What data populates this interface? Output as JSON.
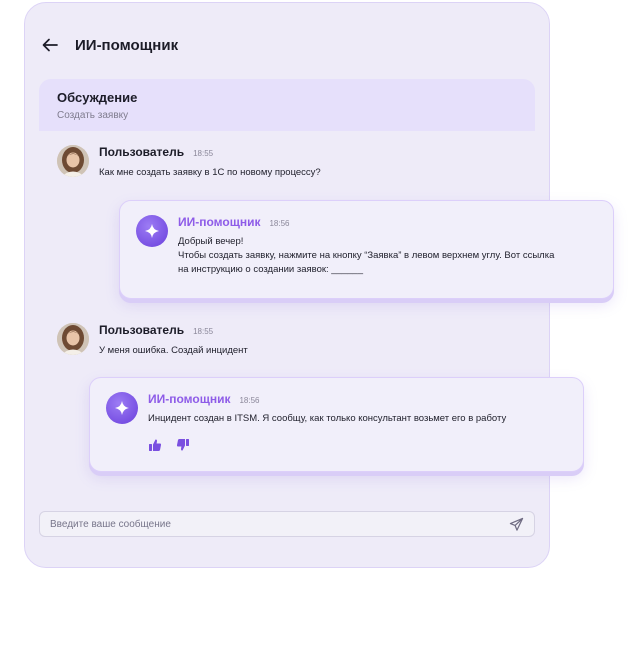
{
  "header": {
    "title": "ИИ-помощник",
    "back_icon": "arrow-left-icon"
  },
  "discussion": {
    "title": "Обсуждение",
    "subtitle": "Создать заявку"
  },
  "messages": [
    {
      "author": "Пользователь",
      "time": "18:55",
      "lines": [
        "Как мне создать заявку в 1С по новому процессу?"
      ]
    },
    {
      "author": "ИИ-помощник",
      "time": "18:56",
      "lines": [
        "Добрый вечер!",
        "Чтобы создать заявку, нажмите на кнопку “Заявка” в левом верхнем углу. Вот ссылка",
        "на инструкцию о создании заявок: ______"
      ]
    },
    {
      "author": "Пользователь",
      "time": "18:55",
      "lines": [
        "У меня ошибка. Создай инцидент"
      ]
    },
    {
      "author": "ИИ-помощник",
      "time": "18:56",
      "lines": [
        "Инцидент создан в ITSM. Я сообщу, как только консультант возьмет его в работу"
      ]
    }
  ],
  "reactions": {
    "like_icon": "thumbs-up-icon",
    "dislike_icon": "thumbs-down-icon"
  },
  "input": {
    "placeholder": "Введите ваше сообщение",
    "value": "",
    "send_icon": "send-icon"
  },
  "colors": {
    "accent": "#8e5ce8",
    "panel_bg": "#eeebf8",
    "bot_avatar": "#6a3fdc"
  }
}
